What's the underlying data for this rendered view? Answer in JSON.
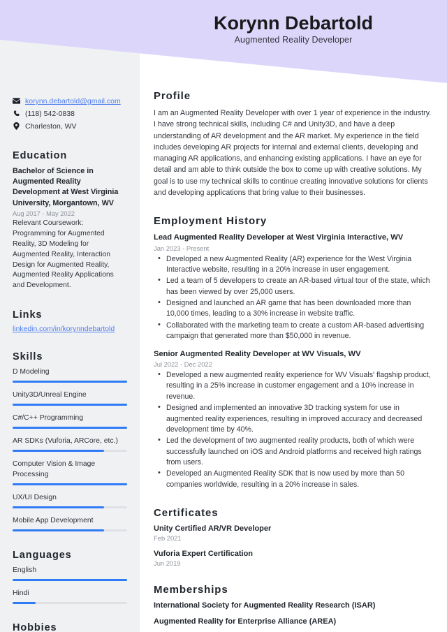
{
  "header": {
    "name": "Korynn Debartold",
    "job_title": "Augmented Reality Developer",
    "banner_color": "#ddd6fb"
  },
  "sidebar": {
    "contact": {
      "email": "korynn.debartold@gmail.com",
      "email_icon": "envelope-icon",
      "phone": "(118) 542-0838",
      "phone_icon": "phone-icon",
      "location": "Charleston, WV",
      "location_icon": "map-pin-icon"
    },
    "education": {
      "heading": "Education",
      "degree": "Bachelor of Science in Augmented Reality Development at West Virginia University, Morgantown, WV",
      "date": "Aug 2017 - May 2022",
      "description": "Relevant Coursework: Programming for Augmented Reality, 3D Modeling for Augmented Reality, Interaction Design for Augmented Reality, Augmented Reality Applications and Development."
    },
    "links": {
      "heading": "Links",
      "items": [
        {
          "label": "linkedin.com/in/korynndebartold"
        }
      ]
    },
    "skills": {
      "heading": "Skills",
      "accent_color": "#2f7bf6",
      "track_color": "#dfe1e5",
      "items": [
        {
          "label": "D Modeling",
          "level": 100
        },
        {
          "label": "Unity3D/Unreal Engine",
          "level": 100
        },
        {
          "label": "C#/C++ Programming",
          "level": 100
        },
        {
          "label": "AR SDKs (Vuforia, ARCore, etc.)",
          "level": 80
        },
        {
          "label": "Computer Vision & Image Processing",
          "level": 100
        },
        {
          "label": "UX/UI Design",
          "level": 80
        },
        {
          "label": "Mobile App Development",
          "level": 80
        }
      ]
    },
    "languages": {
      "heading": "Languages",
      "items": [
        {
          "label": "English",
          "level": 100
        },
        {
          "label": "Hindi",
          "level": 20
        }
      ]
    },
    "hobbies": {
      "heading": "Hobbies"
    }
  },
  "main": {
    "profile": {
      "heading": "Profile",
      "text": "I am an Augmented Reality Developer with over 1 year of experience in the industry. I have strong technical skills, including C# and Unity3D, and have a deep understanding of AR development and the AR market. My experience in the field includes developing AR projects for internal and external clients, developing and managing AR applications, and enhancing existing applications. I have an eye for detail and am able to think outside the box to come up with creative solutions. My goal is to use my technical skills to continue creating innovative solutions for clients and developing applications that bring value to their businesses."
    },
    "employment": {
      "heading": "Employment History",
      "jobs": [
        {
          "title": "Lead Augmented Reality Developer at West Virginia Interactive, WV",
          "date": "Jan 2023 - Present",
          "bullets": [
            "Developed a new Augmented Reality (AR) experience for the West Virginia Interactive website, resulting in a 20% increase in user engagement.",
            "Led a team of 5 developers to create an AR-based virtual tour of the state, which has been viewed by over 25,000 users.",
            "Designed and launched an AR game that has been downloaded more than 10,000 times, leading to a 30% increase in website traffic.",
            "Collaborated with the marketing team to create a custom AR-based advertising campaign that generated more than $50,000 in revenue."
          ]
        },
        {
          "title": "Senior Augmented Reality Developer at WV Visuals, WV",
          "date": "Jul 2022 - Dec 2022",
          "bullets": [
            "Developed a new augmented reality experience for WV Visuals' flagship product, resulting in a 25% increase in customer engagement and a 10% increase in revenue.",
            "Designed and implemented an innovative 3D tracking system for use in augmented reality experiences, resulting in improved accuracy and decreased development time by 40%.",
            "Led the development of two augmented reality products, both of which were successfully launched on iOS and Android platforms and received high ratings from users.",
            "Developed an Augmented Reality SDK that is now used by more than 50 companies worldwide, resulting in a 20% increase in sales."
          ]
        }
      ]
    },
    "certificates": {
      "heading": "Certificates",
      "items": [
        {
          "title": "Unity Certified AR/VR Developer",
          "date": "Feb 2021"
        },
        {
          "title": "Vuforia Expert Certification",
          "date": "Jun 2019"
        }
      ]
    },
    "memberships": {
      "heading": "Memberships",
      "items": [
        {
          "title": "International Society for Augmented Reality Research (ISAR)"
        },
        {
          "title": "Augmented Reality for Enterprise Alliance (AREA)"
        }
      ]
    }
  }
}
